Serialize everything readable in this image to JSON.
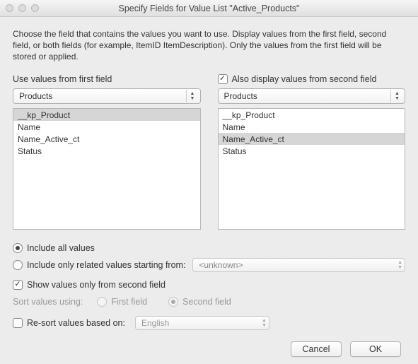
{
  "window": {
    "title": "Specify Fields for Value List \"Active_Products\""
  },
  "description": "Choose the field that contains the values you want to use.  Display values from the first field, second field, or both fields (for example, ItemID ItemDescription). Only the values from the first field will be stored or applied.",
  "left": {
    "header": "Use values from first field",
    "dropdown": "Products",
    "items": [
      "__kp_Product",
      "Name",
      "Name_Active_ct",
      "Status"
    ],
    "selected_index": 0
  },
  "right": {
    "checkbox_label": "Also display values from second field",
    "checkbox_checked": true,
    "dropdown": "Products",
    "items": [
      "__kp_Product",
      "Name",
      "Name_Active_ct",
      "Status"
    ],
    "selected_index": 2
  },
  "options": {
    "include_all": "Include all values",
    "include_related": "Include only related values starting from:",
    "include_related_value": "<unknown>",
    "include_mode": "all",
    "show_second_only": "Show values only from second field",
    "show_second_only_checked": true,
    "sort_label": "Sort values using:",
    "sort_first": "First field",
    "sort_second": "Second field",
    "sort_selected": "second",
    "resort_label": "Re-sort values based on:",
    "resort_checked": false,
    "resort_value": "English"
  },
  "buttons": {
    "cancel": "Cancel",
    "ok": "OK"
  }
}
